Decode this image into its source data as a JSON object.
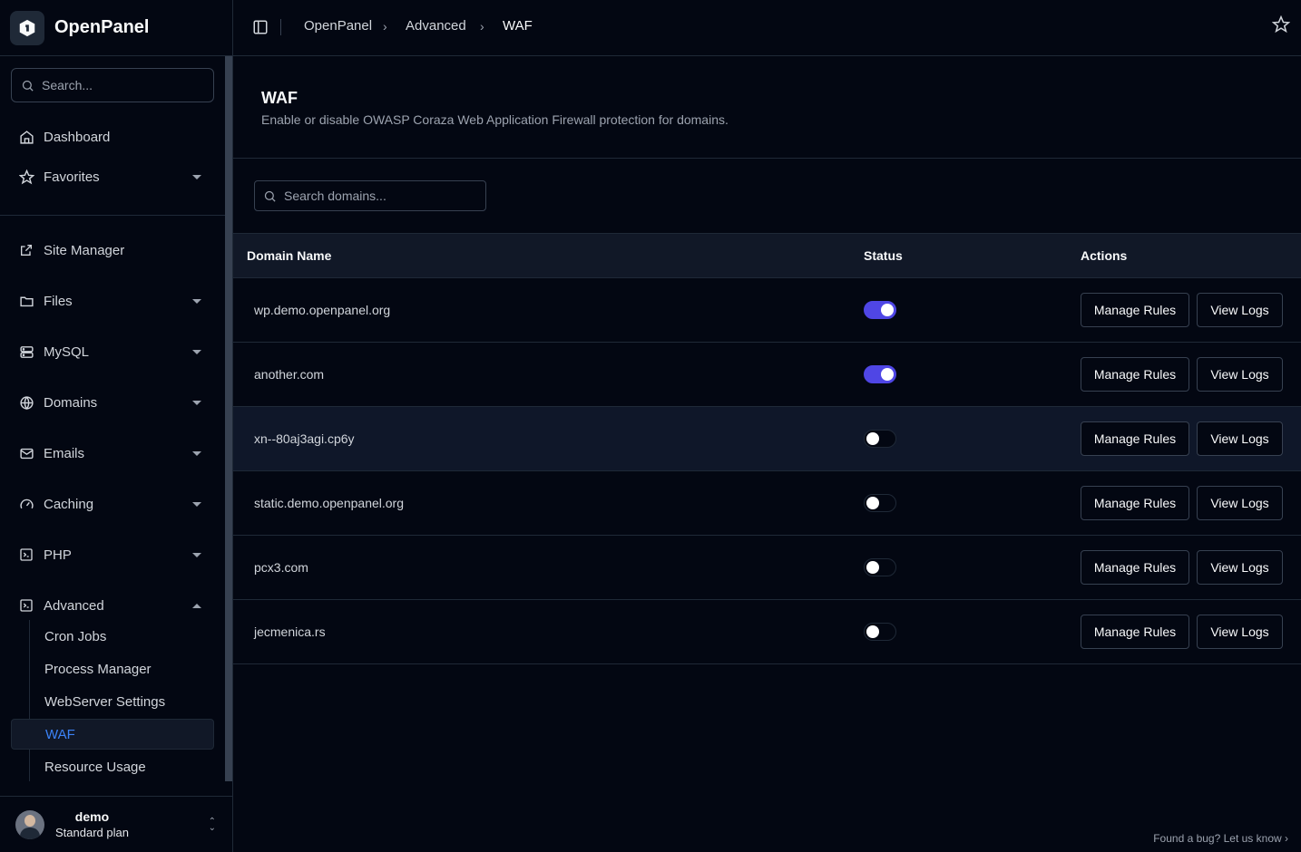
{
  "app": {
    "name": "OpenPanel"
  },
  "sidebar": {
    "search_placeholder": "Search...",
    "items": [
      {
        "label": "Dashboard",
        "icon": "home-icon"
      },
      {
        "label": "Favorites",
        "icon": "star-icon"
      },
      {
        "label": "Site Manager",
        "icon": "external-link-icon"
      },
      {
        "label": "Files",
        "icon": "folder-icon"
      },
      {
        "label": "MySQL",
        "icon": "database-icon"
      },
      {
        "label": "Domains",
        "icon": "globe-www-icon"
      },
      {
        "label": "Emails",
        "icon": "mail-icon"
      },
      {
        "label": "Caching",
        "icon": "gauge-icon"
      },
      {
        "label": "PHP",
        "icon": "php-icon"
      },
      {
        "label": "Advanced",
        "icon": "terminal-icon"
      }
    ],
    "sub_items": [
      {
        "label": "Cron Jobs"
      },
      {
        "label": "Process Manager"
      },
      {
        "label": "WebServer Settings"
      },
      {
        "label": "WAF",
        "active": true
      },
      {
        "label": "Resource Usage"
      }
    ]
  },
  "user": {
    "name": "demo",
    "plan": "Standard plan"
  },
  "breadcrumb": [
    "OpenPanel",
    "Advanced",
    "WAF"
  ],
  "page": {
    "title": "WAF",
    "description": "Enable or disable OWASP Coraza Web Application Firewall protection for domains."
  },
  "search": {
    "placeholder": "Search domains..."
  },
  "table": {
    "headers": {
      "domain": "Domain Name",
      "status": "Status",
      "actions": "Actions"
    },
    "rows": [
      {
        "domain": "wp.demo.openpanel.org",
        "enabled": true
      },
      {
        "domain": "another.com",
        "enabled": true
      },
      {
        "domain": "xn--80aj3agi.cp6y",
        "enabled": false
      },
      {
        "domain": "static.demo.openpanel.org",
        "enabled": false
      },
      {
        "domain": "pcx3.com",
        "enabled": false
      },
      {
        "domain": "jecmenica.rs",
        "enabled": false
      }
    ],
    "manage_rules_label": "Manage Rules",
    "view_logs_label": "View Logs"
  },
  "footer": {
    "bug_text": "Found a bug? Let us know"
  },
  "colors": {
    "accent": "#4f46e5",
    "active_link": "#3b82f6",
    "background": "#030712"
  }
}
